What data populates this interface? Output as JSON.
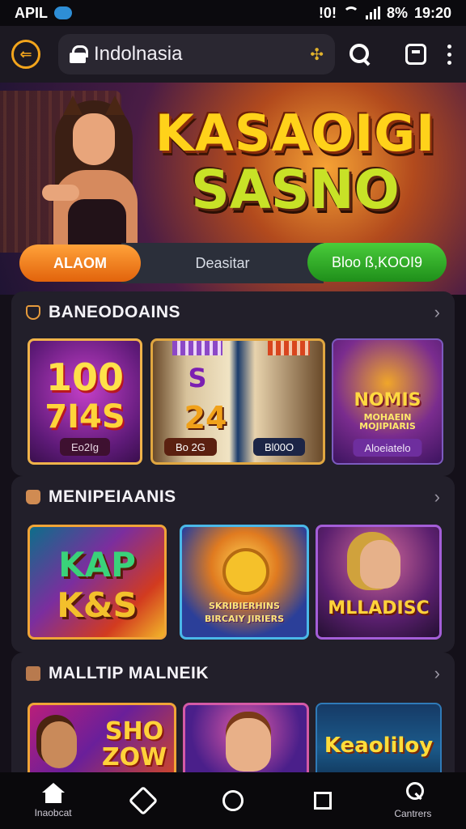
{
  "status_bar": {
    "carrier": "APIL",
    "signal_extra": "!0!",
    "battery": "8%",
    "time": "19:20"
  },
  "app_bar": {
    "url": "Indolnasia"
  },
  "hero": {
    "title_line1": "KASAOIGI",
    "title_line2": "SASNO",
    "button_left": "ALAOM",
    "center_text": "Deasitar",
    "button_right": "Bloo ß,KOOI9"
  },
  "sections": [
    {
      "title": "BANEODOAINS",
      "cards": [
        {
          "big1": "100",
          "big2": "7I4S",
          "label": "Eo2Ig"
        },
        {
          "big1": "S",
          "big2": "24",
          "label_left": "Bo 2G",
          "label_right": "Bl00O"
        },
        {
          "big1": "NOMIS",
          "big2": "MOHAEIN MOJIPIARIS",
          "label": "Aloeiatelo"
        }
      ]
    },
    {
      "title": "MENIPEIAANIS",
      "cards": [
        {
          "big1": "KAP",
          "big2": "K&S"
        },
        {
          "big1": "SKRIBIERHINS",
          "big2": "BIRCAIY JIRIERS"
        },
        {
          "big1": "MLLADISC"
        }
      ]
    },
    {
      "title": "MALLTIP MALNEIK",
      "cards": [
        {
          "big1": "SHO",
          "big2": "ZOW"
        },
        {
          "big1": ""
        },
        {
          "big1": "Keaoliloy"
        }
      ]
    }
  ],
  "bottom_nav": [
    {
      "label": "Inaobcat",
      "icon": "home-icon"
    },
    {
      "label": "",
      "icon": "puzzle-icon"
    },
    {
      "label": "",
      "icon": "circle-icon"
    },
    {
      "label": "",
      "icon": "square-icon"
    },
    {
      "label": "Cantrers",
      "icon": "person-icon"
    }
  ]
}
